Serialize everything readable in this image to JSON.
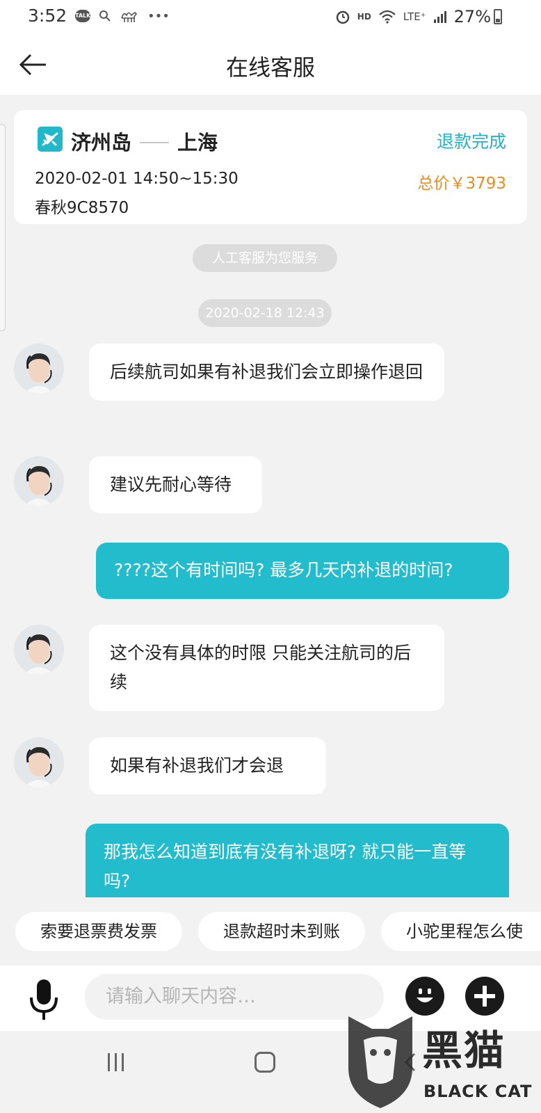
{
  "status_bar": {
    "time": "3:52",
    "talk_badge": "TALK",
    "hd": "HD",
    "lte": "LTE⁺",
    "battery": "27%",
    "battery_level": 0.27
  },
  "header": {
    "title": "在线客服"
  },
  "flight_card": {
    "from": "济州岛",
    "to": "上海",
    "status": "退款完成",
    "time": "2020-02-01 14:50~15:30",
    "flight": "春秋9C8570",
    "price": "总价￥3793"
  },
  "system": {
    "service_notice": "人工客服为您服务",
    "timestamp": "2020-02-18 12:43"
  },
  "messages": [
    {
      "from": "agent",
      "text": "后续航司如果有补退我们会立即操作退回"
    },
    {
      "from": "agent",
      "text": "建议先耐心等待"
    },
    {
      "from": "me",
      "text": "????这个有时间吗? 最多几天内补退的时间?"
    },
    {
      "from": "agent",
      "text": "这个没有具体的时限 只能关注航司的后续"
    },
    {
      "from": "agent",
      "text": "如果有补退我们才会退"
    },
    {
      "from": "me",
      "text": "那我怎么知道到底有没有补退呀? 就只能一直等吗?"
    }
  ],
  "quick_replies": [
    "索要退票费发票",
    "退款超时未到账",
    "小驼里程怎么使"
  ],
  "input": {
    "placeholder": "请输入聊天内容…"
  },
  "watermark": {
    "cn": "黑猫",
    "en": "BLACK CAT"
  },
  "colors": {
    "accent": "#22bccc",
    "price": "#ee8b1e",
    "status": "#21b2c4"
  }
}
